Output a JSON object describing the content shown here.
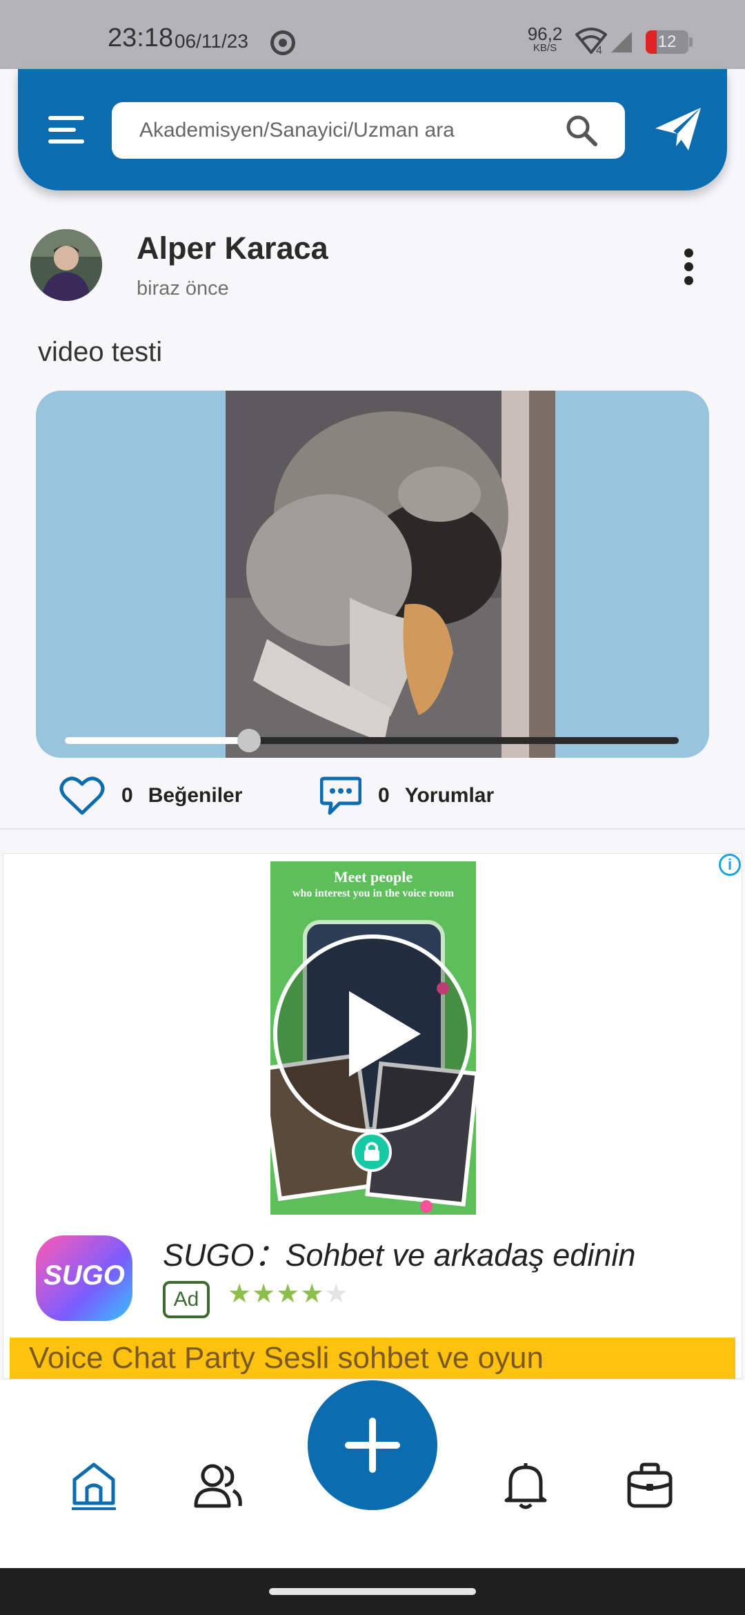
{
  "status_bar": {
    "time": "23:18",
    "date": "06/11/23",
    "net_speed": "96,2",
    "net_unit": "KB/S",
    "wifi_label": "4",
    "battery": "12"
  },
  "header": {
    "search_placeholder": "Akademisyen/Sanayici/Uzman ara",
    "menu_icon": "hamburger-icon",
    "search_icon": "search-icon",
    "send_icon": "paper-plane-icon",
    "accent": "#0b6cb0"
  },
  "post": {
    "author": "Alper Karaca",
    "time": "biraz önce",
    "text": "video testi",
    "video_progress": 0.3,
    "likes_count": "0",
    "likes_label": "Beğeniler",
    "comments_count": "0",
    "comments_label": "Yorumlar"
  },
  "ad": {
    "info": "i",
    "creative_headline": "Meet people",
    "creative_subline": "who interest you in the voice room",
    "logo_text": "SUGO",
    "title": "SUGO：Sohbet ve arkadaş edinin",
    "badge": "Ad",
    "rating": 4,
    "rating_max": 5,
    "cta_text": "Voice Chat Party Sesli sohbet ve oyun",
    "cta_color": "#ffc20e"
  },
  "bottom_nav": {
    "items": [
      "home-icon",
      "people-icon",
      "add-icon",
      "bell-icon",
      "briefcase-icon"
    ],
    "active": "home"
  }
}
